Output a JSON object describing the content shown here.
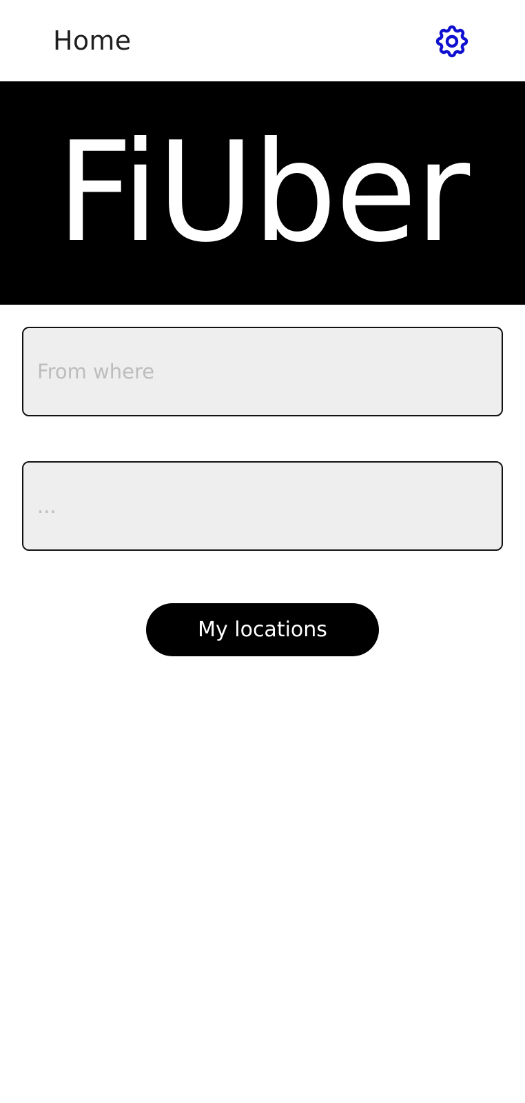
{
  "header": {
    "title": "Home",
    "settings_icon": "gear-icon",
    "settings_icon_color": "#1010d0"
  },
  "banner": {
    "logo_text": "FiUber",
    "background_color": "#000000",
    "text_color": "#ffffff"
  },
  "form": {
    "from_field": {
      "value": "",
      "placeholder": "From where"
    },
    "to_field": {
      "value": "",
      "placeholder": "..."
    }
  },
  "actions": {
    "my_locations_label": "My locations"
  }
}
